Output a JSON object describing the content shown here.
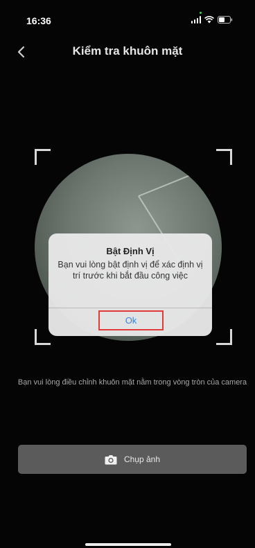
{
  "status_bar": {
    "time": "16:36"
  },
  "header": {
    "title": "Kiểm tra khuôn mặt"
  },
  "camera": {
    "hint": "Bạn vui lòng điều chỉnh khuôn mặt nằm trong vòng tròn của camera"
  },
  "capture": {
    "label": "Chụp ảnh"
  },
  "dialog": {
    "title": "Bật Định Vị",
    "message": "Bạn vui lòng bật định vị để xác định vị trí trước khi bắt đầu công việc",
    "ok_label": "Ok"
  },
  "colors": {
    "background": "#050505",
    "button": "#5b5b5b",
    "dialog_bg": "#e8e8e8",
    "ok_text": "#3b82d9",
    "ok_highlight": "#e13a3a"
  }
}
